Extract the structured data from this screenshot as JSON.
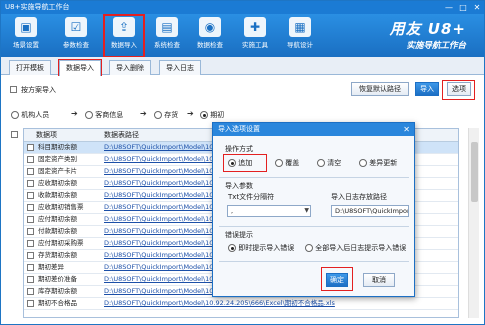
{
  "window": {
    "title": "U8+实施导航工作台",
    "controls": [
      "—",
      "□",
      "✕"
    ]
  },
  "ribbon": {
    "items": [
      {
        "label": "场景设置",
        "icon": "scene-settings-icon",
        "glyph": "▣"
      },
      {
        "label": "参数检查",
        "icon": "param-check-icon",
        "glyph": "☑"
      },
      {
        "label": "数据导入",
        "icon": "data-import-icon",
        "glyph": "⇪"
      },
      {
        "label": "系统检查",
        "icon": "system-check-icon",
        "glyph": "▤"
      },
      {
        "label": "数据检查",
        "icon": "data-check-icon",
        "glyph": "◉"
      },
      {
        "label": "实施工具",
        "icon": "tools-icon",
        "glyph": "✚"
      },
      {
        "label": "导航设计",
        "icon": "nav-design-icon",
        "glyph": "▦"
      }
    ],
    "brand": {
      "line1": "用友 U8+",
      "line2": "实施导航工作台"
    }
  },
  "tabs": [
    "打开模板",
    "数据导入",
    "导入删除",
    "导入日志"
  ],
  "toolbar": {
    "by_import": "按方案导入",
    "restore_default_path": "恢复默认路径",
    "import": "导入",
    "options": "选项"
  },
  "modules": [
    "机构人员",
    "客商信息",
    "存货",
    "期初",
    "生产制造",
    "基础",
    "业务数据"
  ],
  "grid": {
    "col_item": "数据项",
    "col_path": "数据表路径",
    "rows": [
      {
        "item": "科目期初余额",
        "path": "D:\\U8SOFT\\QuickImport\\Model\\10.92.24.205\\666\\Excel\\科目期初余额.xls"
      },
      {
        "item": "固定资产类别",
        "path": "D:\\U8SOFT\\QuickImport\\Model\\10.92.24.205\\666\\Excel\\固定资产类别.xls"
      },
      {
        "item": "固定资产卡片",
        "path": "D:\\U8SOFT\\QuickImport\\Model\\10.92.24.205\\666\\Excel\\固定资产卡片.xls"
      },
      {
        "item": "应收期初余额",
        "path": "D:\\U8SOFT\\QuickImport\\Model\\10.92.24.205\\666\\Excel\\应收期初余额.xls"
      },
      {
        "item": "收款期初余额",
        "path": "D:\\U8SOFT\\QuickImport\\Model\\10.92.24.205\\666\\Excel\\收款期初余额.xls"
      },
      {
        "item": "应收期初销售票",
        "path": "D:\\U8SOFT\\QuickImport\\Model\\10.92.24.205\\666\\Excel\\应收期初销售票.xls"
      },
      {
        "item": "应付期初余额",
        "path": "D:\\U8SOFT\\QuickImport\\Model\\10.92.24.205\\666\\Excel\\应付期初余额.xls"
      },
      {
        "item": "付款期初余额",
        "path": "D:\\U8SOFT\\QuickImport\\Model\\10.92.24.205\\666\\Excel\\付款期初余额.xls"
      },
      {
        "item": "应付期初采购票",
        "path": "D:\\U8SOFT\\QuickImport\\Model\\10.92.24.205\\666\\Excel\\应付期初采购票.xls"
      },
      {
        "item": "存货期初余额",
        "path": "D:\\U8SOFT\\QuickImport\\Model\\10.92.24.205\\666\\Excel\\存货期初余额.xls"
      },
      {
        "item": "期初差异",
        "path": "D:\\U8SOFT\\QuickImport\\Model\\10.92.24.205\\666\\Excel\\期初差异.xls"
      },
      {
        "item": "期初差价准备",
        "path": "D:\\U8SOFT\\QuickImport\\Model\\10.92.24.205\\666\\Excel\\期初差价准备.xls"
      },
      {
        "item": "库存期初余额",
        "path": "D:\\U8SOFT\\QuickImport\\Model\\10.92.24.205\\666\\Excel\\库存期初余额.xls"
      },
      {
        "item": "期初不合格品",
        "path": "D:\\U8SOFT\\QuickImport\\Model\\10.92.24.205\\666\\Excel\\期初不合格品.xls"
      }
    ]
  },
  "dialog": {
    "title": "导入选项设置",
    "close": "✕",
    "op_mode_label": "操作方式",
    "op_modes": [
      "追加",
      "覆盖",
      "清空",
      "差异更新"
    ],
    "import_params_label": "导入参数",
    "txt_separator_label": "Txt文件分隔符",
    "txt_separator_value": ",",
    "log_path_label": "导入日志存放路径",
    "log_path_value": "D:\\U8SOFT\\QuickImport\\Lo",
    "error_label": "错误提示",
    "error_opts": [
      "即时提示导入错误",
      "全部导入后日志提示导入错误"
    ],
    "ok": "确定",
    "cancel": "取消"
  },
  "colors": {
    "accent": "#1b7bd4",
    "highlight": "#e32020"
  }
}
